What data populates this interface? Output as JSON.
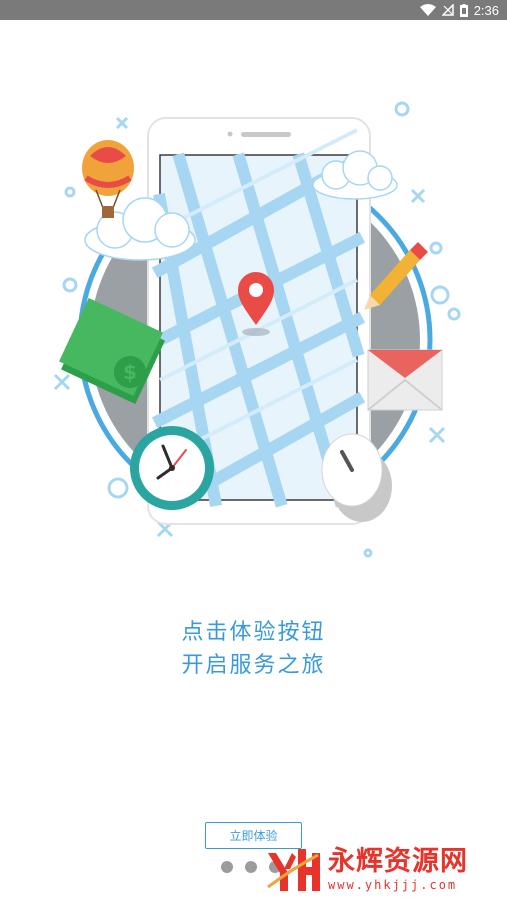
{
  "status_bar": {
    "time": "2:36"
  },
  "slogan": {
    "line1": "点击体验按钮",
    "line2": "开启服务之旅"
  },
  "start_button": {
    "label": "立即体验"
  },
  "pager": {
    "pages": 3,
    "current": 3
  },
  "watermark": {
    "name": "永辉资源网",
    "url": "www.yhkjjj.com"
  },
  "colors": {
    "accent": "#3a9ad9",
    "status_bar": "#7a7a7a",
    "watermark": "#e8332b",
    "pin": "#e94b47"
  },
  "icons": [
    "wifi-icon",
    "signal-icon",
    "battery-icon",
    "location-pin-icon",
    "clock-icon",
    "mouse-icon",
    "envelope-icon",
    "pencil-icon",
    "money-icon",
    "hot-air-balloon-icon"
  ]
}
